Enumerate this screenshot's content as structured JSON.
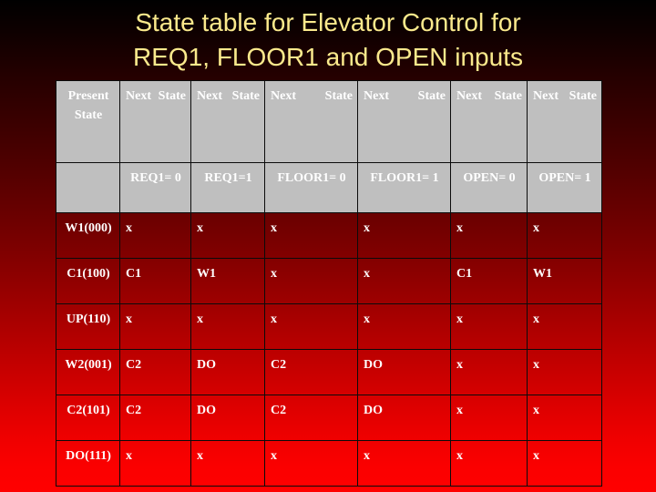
{
  "slide": {
    "title_lines": [
      "State table for Elevator Control for",
      "REQ1, FLOOR1 and OPEN inputs"
    ],
    "title_color": "#fae98c",
    "background_top_color": "#000000",
    "background_bottom_color": "#ff0000"
  },
  "table": {
    "header_background": "#bfbfbf",
    "header_text_color": "#ffffff",
    "body_text_color": "#ffffff",
    "border_color": "#0b0b0b",
    "header_row_1": [
      "Present State",
      "Next State",
      "Next State",
      "Next State",
      "Next State",
      "Next State",
      "Next State"
    ],
    "header_row_2": [
      "",
      "REQ1= 0",
      "REQ1=1",
      "FLOOR1= 0",
      "FLOOR1= 1",
      "OPEN= 0",
      "OPEN= 1"
    ],
    "rows": [
      {
        "present_state": "W1(000)",
        "next_states": [
          "x",
          "x",
          "x",
          "x",
          "x",
          "x"
        ]
      },
      {
        "present_state": "C1(100)",
        "next_states": [
          "C1",
          "W1",
          "x",
          "x",
          "C1",
          "W1"
        ]
      },
      {
        "present_state": "UP(110)",
        "next_states": [
          "x",
          "x",
          "x",
          "x",
          "x",
          "x"
        ]
      },
      {
        "present_state": "W2(001)",
        "next_states": [
          "C2",
          "DO",
          "C2",
          "DO",
          "x",
          "x"
        ]
      },
      {
        "present_state": "C2(101)",
        "next_states": [
          "C2",
          "DO",
          "C2",
          "DO",
          "x",
          "x"
        ]
      },
      {
        "present_state": "DO(111)",
        "next_states": [
          "x",
          "x",
          "x",
          "x",
          "x",
          "x"
        ]
      }
    ]
  }
}
